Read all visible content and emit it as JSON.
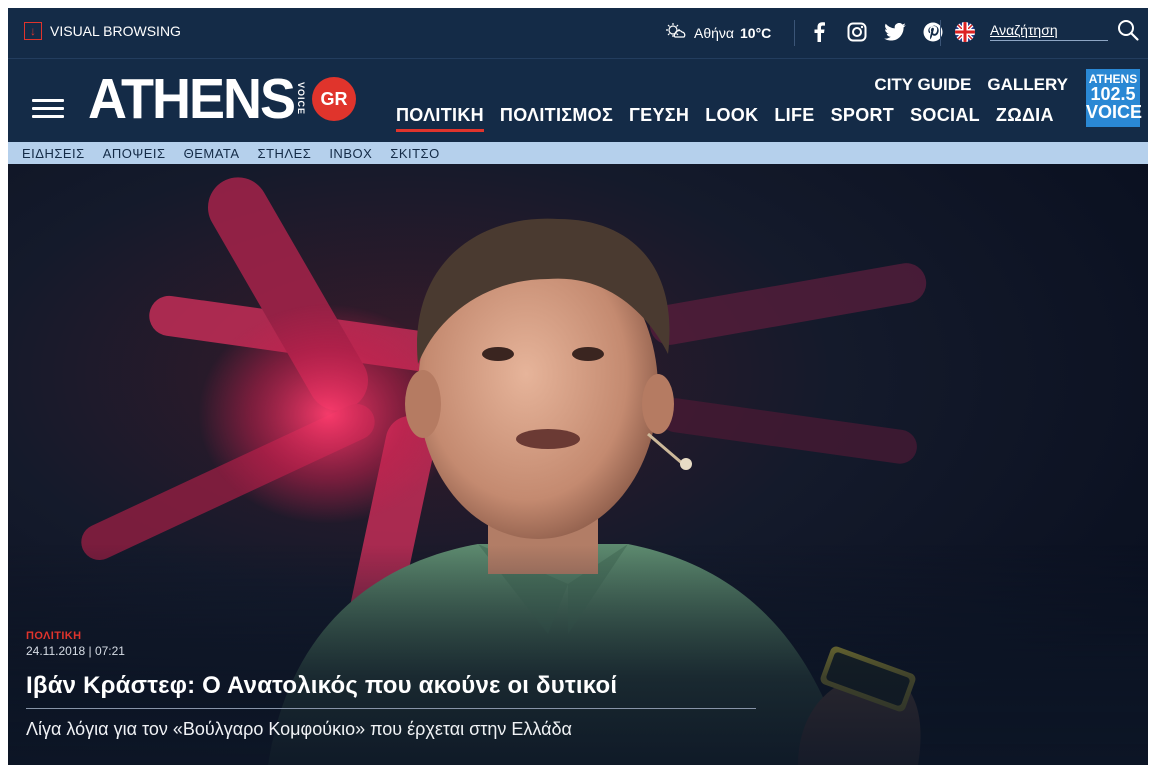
{
  "topbar": {
    "visual_browsing": "VISUAL BROWSING",
    "weather_city": "Αθήνα",
    "weather_temp": "10°C",
    "search_placeholder": "Αναζήτηση"
  },
  "header": {
    "logo": "ATHENS",
    "logo_voice": "VOICE",
    "logo_gr": "GR",
    "nav_top": [
      "CITY GUIDE",
      "GALLERY"
    ],
    "nav_main": [
      "ΠΟΛΙΤΙΚΗ",
      "ΠΟΛΙΤΙΣΜΟΣ",
      "ΓΕΥΣΗ",
      "LOOK",
      "LIFE",
      "SPORT",
      "SOCIAL",
      "ΖΩΔΙΑ"
    ],
    "active_nav": "ΠΟΛΙΤΙΚΗ",
    "radio": [
      "ATHENS",
      "102.5",
      "VOICE"
    ]
  },
  "subnav": [
    "ΕΙΔΗΣΕΙΣ",
    "ΑΠΟΨΕΙΣ",
    "ΘΕΜΑΤΑ",
    "ΣΤΗΛΕΣ",
    "INBOX",
    "ΣΚΙΤΣΟ"
  ],
  "article": {
    "category": "ΠΟΛΙΤΙΚΗ",
    "date": "24.11.2018 | 07:21",
    "title": "Ιβάν Κράστεφ: Ο Ανατολικός που ακούνε οι δυτικοί",
    "lede": "Λίγα λόγια για τον «Βούλγαρο Κομφούκιο» που έρχεται στην Ελλάδα"
  },
  "colors": {
    "navy": "#142b47",
    "accent_red": "#e0342c",
    "subnav_blue": "#b5d0ec",
    "radio_blue": "#2a88d4"
  },
  "icons": [
    "weather-icon",
    "facebook-icon",
    "instagram-icon",
    "twitter-icon",
    "pinterest-icon",
    "uk-flag-icon",
    "search-icon",
    "menu-icon"
  ]
}
